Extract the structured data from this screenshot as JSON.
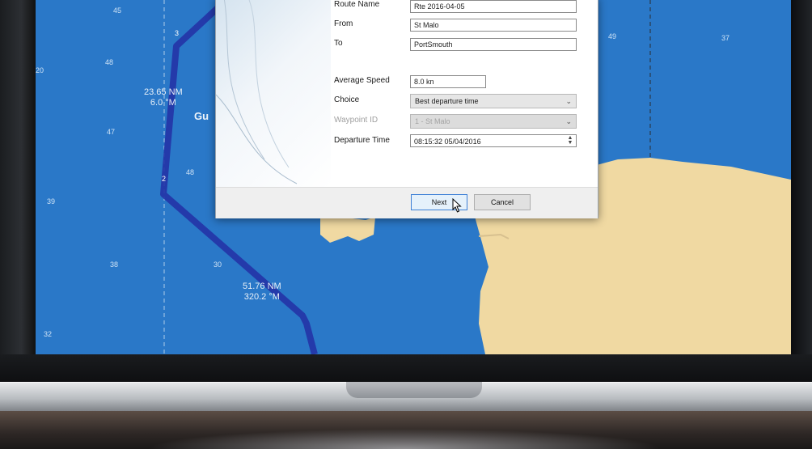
{
  "map": {
    "route_labels": [
      {
        "distance": "23.65 NM",
        "bearing": "6.0 °M"
      },
      {
        "distance": "51.76 NM",
        "bearing": "320.2 °M"
      }
    ],
    "place_label": "Gu",
    "waypoint_labels": [
      "3",
      "2"
    ],
    "depths": [
      "45",
      "48",
      "47",
      "39",
      "38",
      "32",
      "48",
      "30",
      "37",
      "49",
      "20"
    ]
  },
  "dialog": {
    "route_name": {
      "label": "Route Name",
      "value": "Rte 2016-04-05"
    },
    "from": {
      "label": "From",
      "value": "St Malo"
    },
    "to": {
      "label": "To",
      "value": "PortSmouth"
    },
    "average_speed": {
      "label": "Average Speed",
      "value": "8.0 kn"
    },
    "choice": {
      "label": "Choice",
      "value": "Best departure time"
    },
    "waypoint_id": {
      "label": "Waypoint ID",
      "value": "1 - St Malo"
    },
    "departure_time": {
      "label": "Departure Time",
      "value": "08:15:32 05/04/2016"
    },
    "next_label": "Next",
    "cancel_label": "Cancel"
  },
  "colors": {
    "sea": "#2a78c8",
    "land": "#f0d9a2",
    "route": "#2333a6"
  }
}
